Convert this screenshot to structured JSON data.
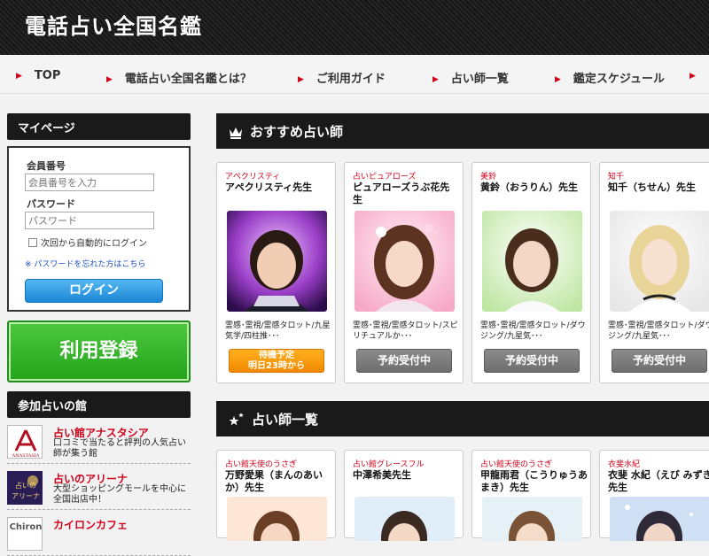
{
  "header": {
    "title": "電話占い全国名鑑"
  },
  "nav": {
    "items": [
      "TOP",
      "電話占い全国名鑑とは？",
      "ご利用ガイド",
      "占い師一覧",
      "鑑定スケジュール"
    ]
  },
  "sidebar": {
    "mypage_title": "マイページ",
    "member_label": "会員番号",
    "member_placeholder": "会員番号を入力",
    "password_label": "パスワード",
    "password_placeholder": "パスワード",
    "auto_login": "次回から自動的にログイン",
    "forgot": "※ パスワードを忘れた方はこちら",
    "login_button": "ログイン",
    "register_button": "利用登録",
    "houses_title": "参加占いの館",
    "houses": [
      {
        "name": "占い館アナスタシア",
        "desc": "口コミで当たると評判の人気占い師が集う館",
        "logo": "ANASTASIA"
      },
      {
        "name": "占いのアリーナ",
        "desc": "大型ショッピングモールを中心に全国出店中！",
        "logo": "占いのアリーナ"
      },
      {
        "name": "カイロンカフェ",
        "desc": "",
        "logo": "Chiron"
      }
    ]
  },
  "recommended": {
    "title": "おすすめ占い師",
    "cards": [
      {
        "house": "アペクリスティ",
        "name": "アペクリスティ先生",
        "tags": "霊感･霊視/霊感タロット/九星気学/四柱推･･･",
        "status": "待機予定\n明日23時から",
        "status_type": "wait"
      },
      {
        "house": "占いピュアローズ",
        "name": "ピュアローズうぶ花先生",
        "tags": "霊感･霊視/霊感タロット/スピリチュアルか･･･",
        "status": "予約受付中",
        "status_type": "accept"
      },
      {
        "house": "美鈴",
        "name": "黄鈴（おうりん）先生",
        "tags": "霊感･霊視/霊感タロット/ダウジング/九星気･･･",
        "status": "予約受付中",
        "status_type": "accept"
      },
      {
        "house": "知千",
        "name": "知千（ちせん）先生",
        "tags": "霊感･霊視/霊感タロット/ダウジング/九星気･･･",
        "status": "予約受付中",
        "status_type": "accept"
      }
    ]
  },
  "fortune_list": {
    "title": "占い師一覧",
    "cards": [
      {
        "house": "占い館天使のうさぎ",
        "name": "万野愛果（まんのあいか）先生"
      },
      {
        "house": "占い館グレースフル",
        "name": "中澤希美先生"
      },
      {
        "house": "占い館天使のうさぎ",
        "name": "甲龍雨君（こうりゅうあまき）先生"
      },
      {
        "house": "衣斐水紀",
        "name": "衣斐 水紀（えび みずき）先生"
      }
    ]
  },
  "colors": {
    "accent_red": "#d0021b",
    "register_green": "#22a31a",
    "login_blue": "#1b86d6",
    "wait_orange": "#f28900"
  }
}
